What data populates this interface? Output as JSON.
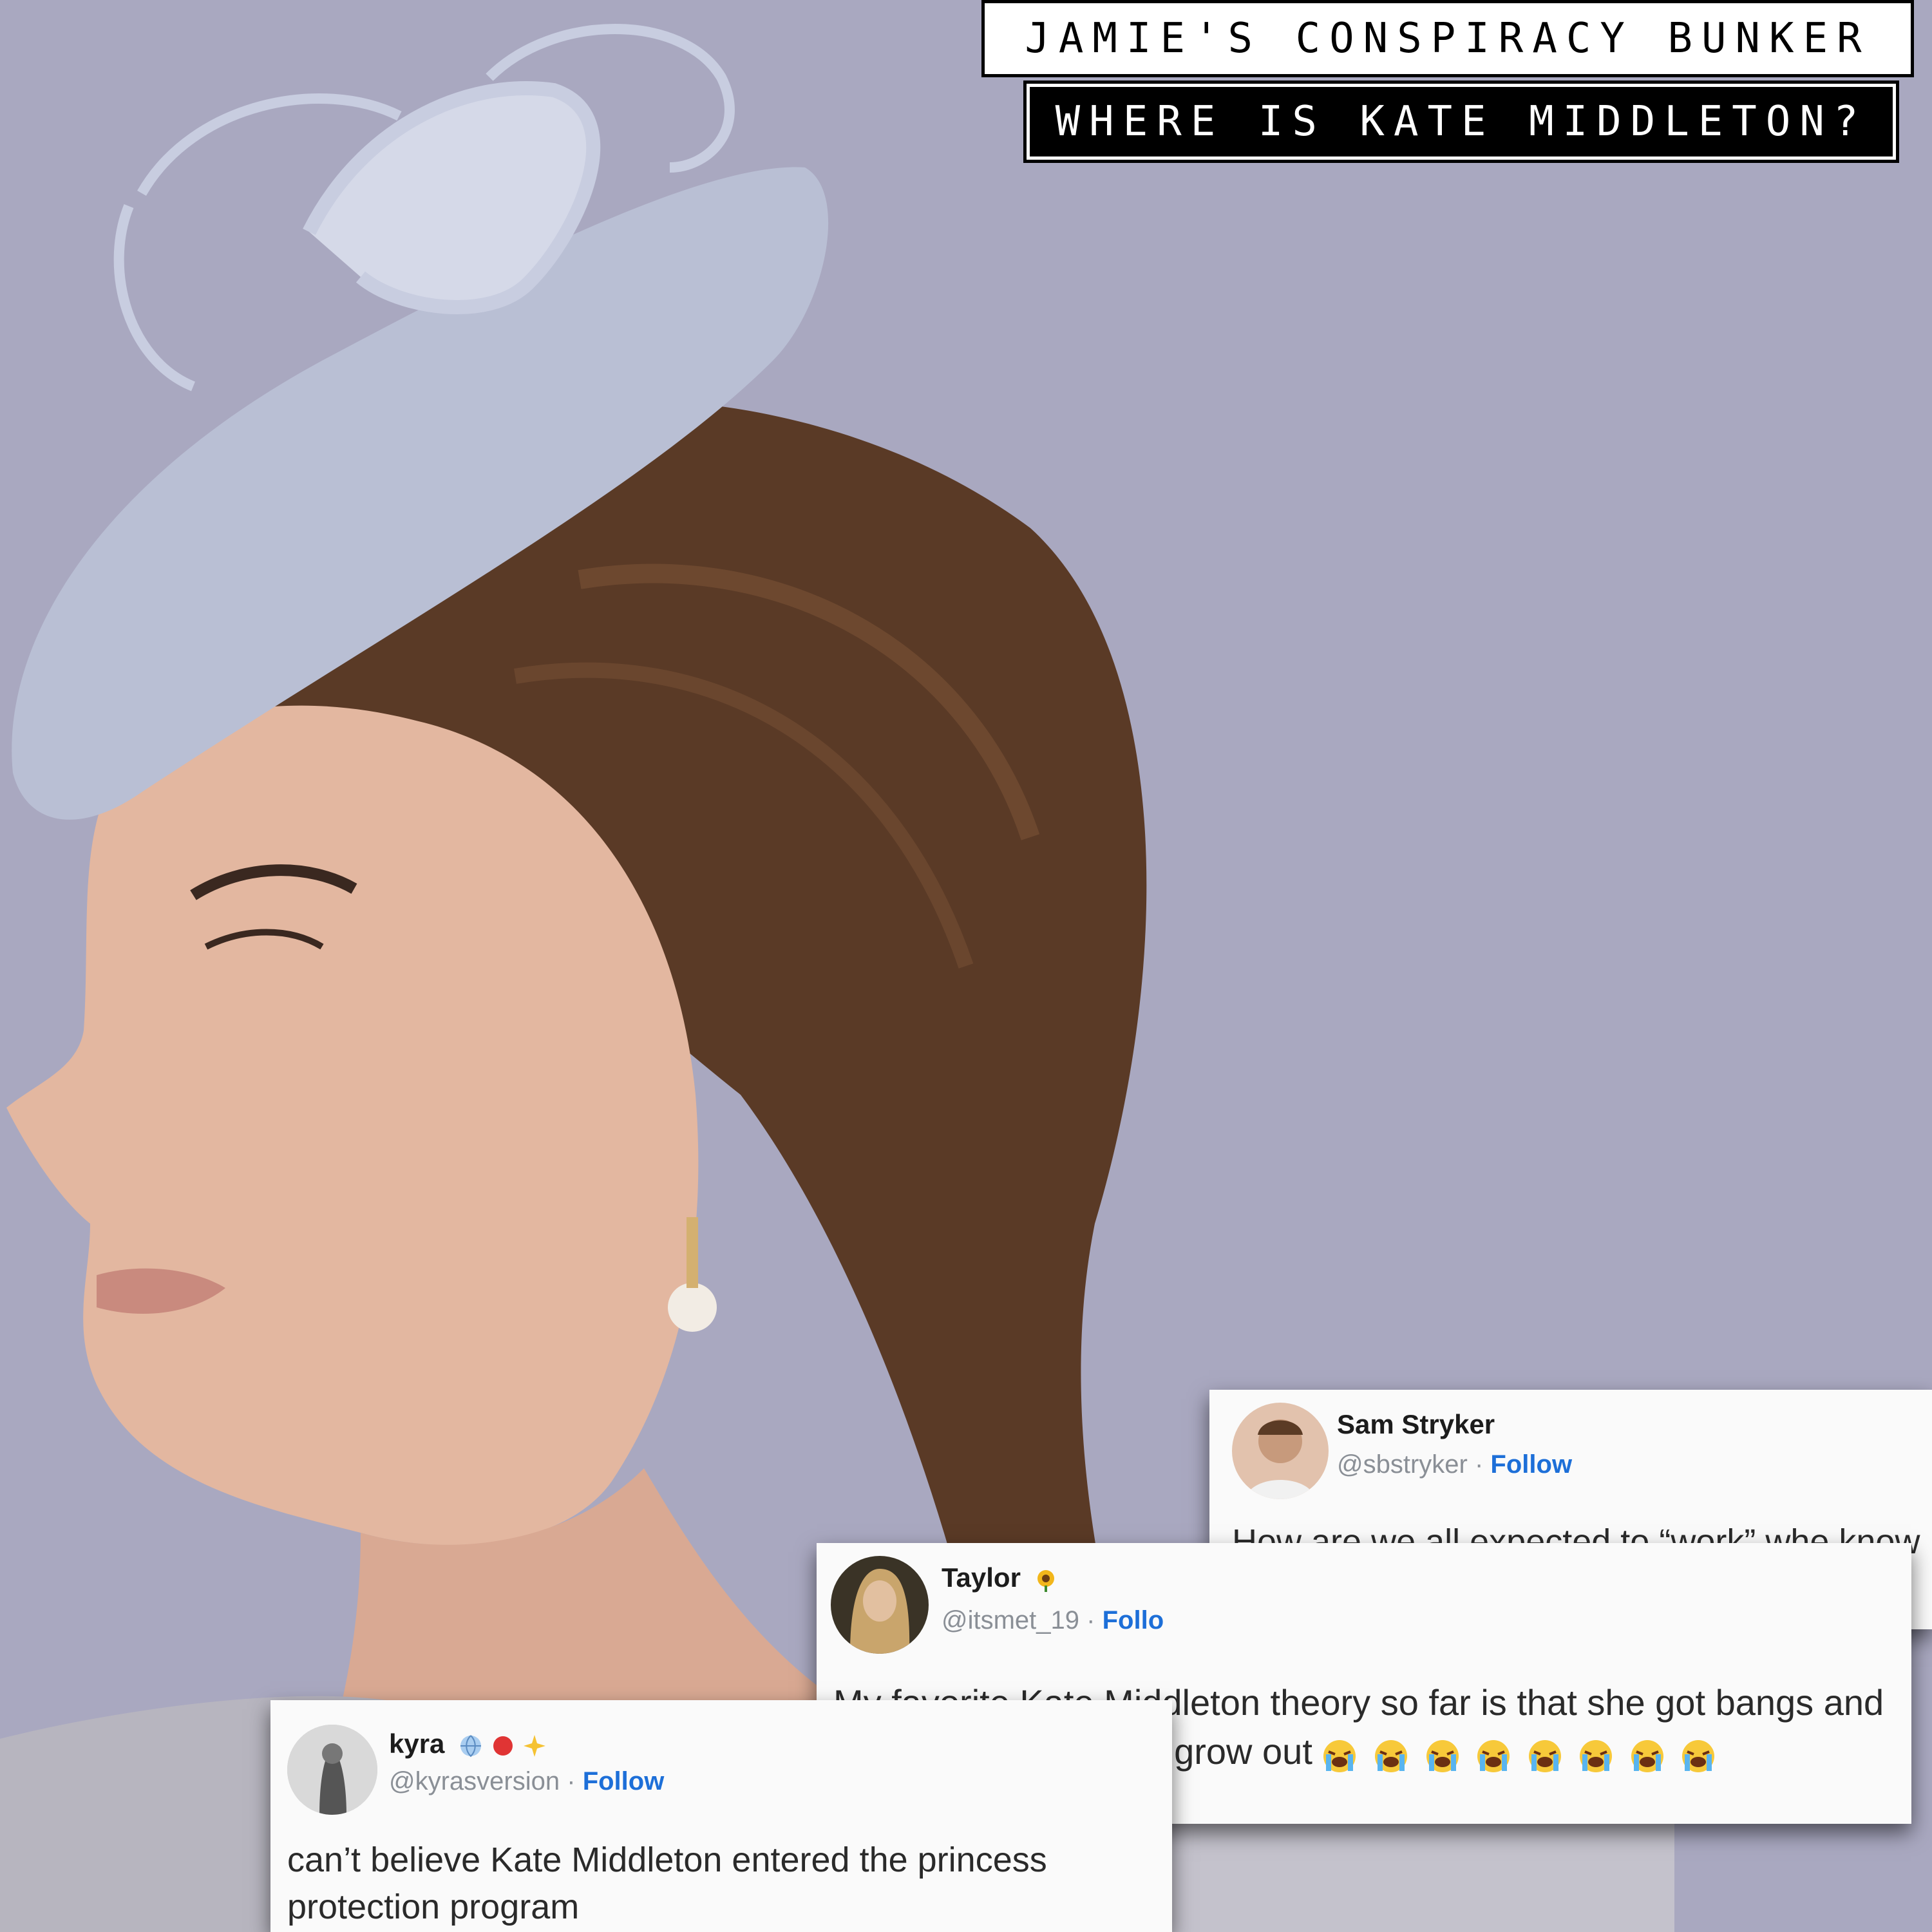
{
  "header": {
    "title": "JAMIE'S CONSPIRACY BUNKER",
    "subtitle": "WHERE IS KATE MIDDLETON?"
  },
  "colors": {
    "background": "#a9a8c0",
    "follow_link": "#1d6fd8"
  },
  "tweets": [
    {
      "name": "Sam Stryker",
      "handle": "@sbstryker",
      "follow_label": "Follow",
      "text": "How are we all expected to “work” whe know where Kate Middleton is"
    },
    {
      "name": "Taylor",
      "handle": "@itsmet_19",
      "follow_label": "Follo",
      "text": "My favorite Kate Middleton theory so far is that she got bangs and is waiting for them to grow out",
      "emoji_count": 8
    },
    {
      "name": "kyra",
      "handle": "@kyrasversion",
      "follow_label": "Follow",
      "text": "can’t believe Kate Middleton entered the princess protection program"
    }
  ]
}
